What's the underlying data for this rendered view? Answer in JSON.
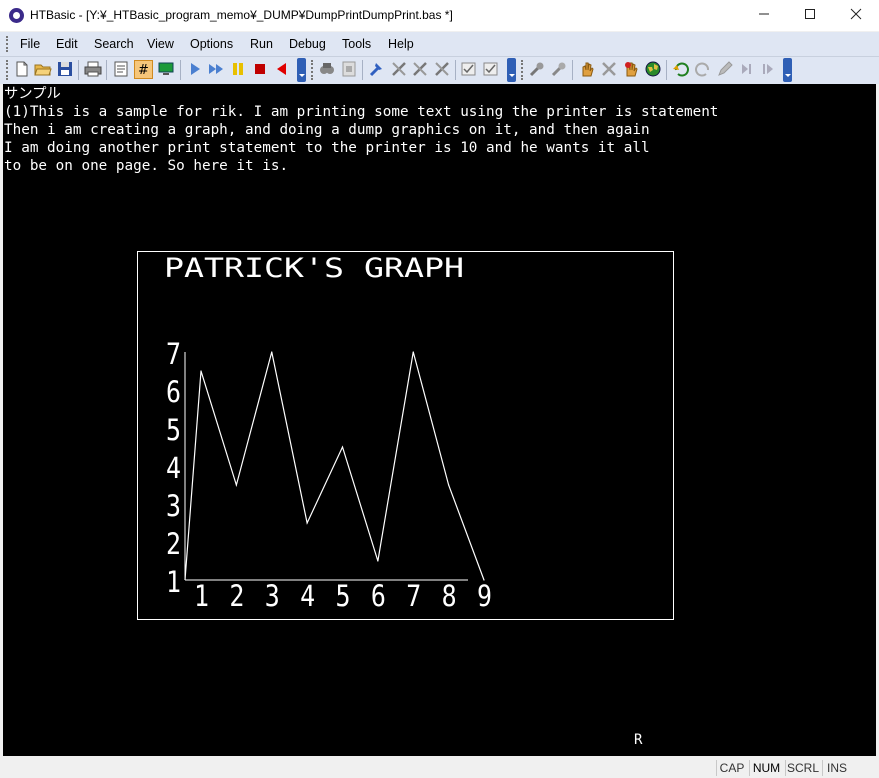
{
  "window": {
    "title": "HTBasic - [Y:¥_HTBasic_program_memo¥_DUMP¥DumpPrintDumpPrint.bas *]",
    "minimize_icon": "minimize-icon",
    "maximize_icon": "maximize-icon",
    "close_icon": "close-icon"
  },
  "menu": [
    "File",
    "Edit",
    "Search",
    "View",
    "Options",
    "Run",
    "Debug",
    "Tools",
    "Help"
  ],
  "toolbar": {
    "icons": [
      "new-file-icon",
      "open-folder-icon",
      "save-icon",
      "print-icon",
      "notes-icon",
      "hash-icon",
      "display-icon",
      "run-icon",
      "fast-forward-icon",
      "pause-icon",
      "stop-icon",
      "back-icon",
      "find-icon",
      "replace-icon",
      "hammer-icon",
      "tools-icon",
      "tools-cross-icon",
      "tools-alt-icon",
      "checklist-icon",
      "checklist-alt-icon",
      "wrench-icon",
      "wrench-alt-icon",
      "hand-icon",
      "tools-x-icon",
      "hand-red-icon",
      "globe-icon",
      "undo-icon",
      "redo-icon",
      "edit-icon",
      "step-icon",
      "step-over-icon"
    ]
  },
  "screen": {
    "lines": [
      "サンプル",
      "(1)This is a sample for rik. I am printing some text using the printer is statement",
      "Then i am creating a graph, and doing a dump graphics on it, and then again",
      "I am doing another print statement to the printer is 10 and he wants it all",
      "to be on one page. So here it is."
    ],
    "cursor_char": "R"
  },
  "chart_data": {
    "type": "line",
    "title": "PATRICK'S GRAPH",
    "x": [
      1,
      2,
      3,
      4,
      5,
      6,
      7,
      8,
      9
    ],
    "values": [
      6.5,
      3.5,
      7,
      2.5,
      4.5,
      1.5,
      7,
      3.5,
      1
    ],
    "x_tick_labels": [
      "1",
      "2",
      "3",
      "4",
      "5",
      "6",
      "7",
      "8",
      "9"
    ],
    "y_tick_labels": [
      "1",
      "2",
      "3",
      "4",
      "5",
      "6",
      "7"
    ],
    "ylim": [
      1,
      7
    ],
    "xlim": [
      1,
      9
    ],
    "start_point": [
      1,
      1
    ],
    "grid": false,
    "line_color": "#ffffff",
    "background": "#000000"
  },
  "statusbar": [
    "CAP",
    "NUM",
    "SCRL",
    "INS"
  ]
}
